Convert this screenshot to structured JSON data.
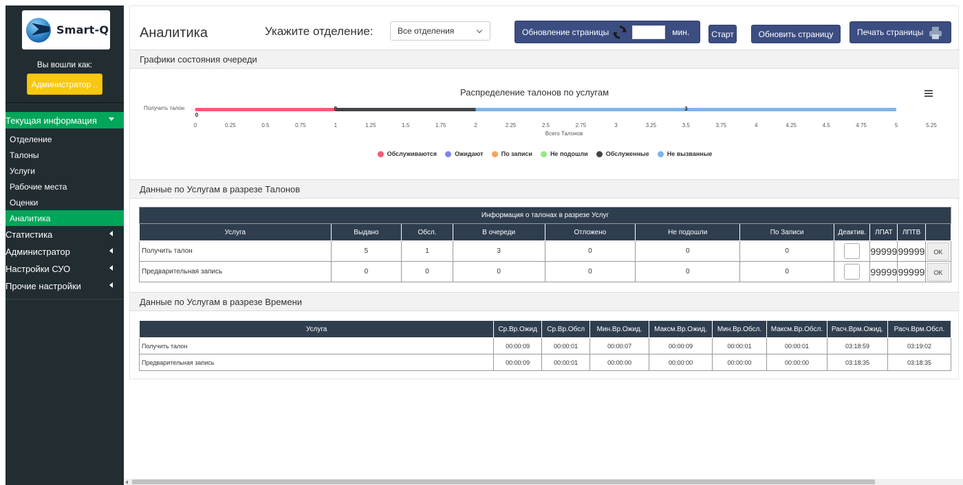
{
  "brand": {
    "name": "Smart-Q"
  },
  "sidebar": {
    "login_label": "Вы вошли как:",
    "role": "Администратор ..",
    "groups": [
      {
        "label": "Текущая информация",
        "expanded": true
      },
      {
        "label": "Статистика"
      },
      {
        "label": "Администратор"
      },
      {
        "label": "Настройки СУО"
      },
      {
        "label": "Прочие настройки"
      }
    ],
    "current_items": [
      "Отделение",
      "Талоны",
      "Услуги",
      "Рабочие места",
      "Оценки",
      "Аналитика"
    ],
    "active_item": "Аналитика"
  },
  "header": {
    "title": "Аналитика",
    "dept_label": "Укажите отделение:",
    "dept_value": "Все отделения",
    "refresh_label": "Обновление страницы",
    "refresh_value": "",
    "refresh_unit": "мин.",
    "start": "Старт",
    "update": "Обновить страницу",
    "print": "Печать страницы"
  },
  "sections": {
    "charts": "Графики состояния очереди",
    "by_tickets": "Данные по Услугам в разрезе Талонов",
    "by_time": "Данные по Услугам в разрезе Времени"
  },
  "chart_data": {
    "type": "bar",
    "orientation": "horizontal",
    "stacked": true,
    "title": "Распределение талонов по услугам",
    "xlabel": "Всего Талонов",
    "categories": [
      "Получить талон"
    ],
    "xlim": [
      0,
      5.25
    ],
    "xticks": [
      "0",
      "0.25",
      "0.5",
      "0.75",
      "1",
      "1.25",
      "1.5",
      "1.75",
      "2",
      "2.25",
      "2.5",
      "2.75",
      "3",
      "3.25",
      "3.5",
      "3.75",
      "4",
      "4.25",
      "4.5",
      "4.75",
      "5",
      "5.25"
    ],
    "series": [
      {
        "name": "Обслуживаются",
        "color": "#f45b7a",
        "values": [
          1
        ]
      },
      {
        "name": "Ожидают",
        "color": "#8085e9",
        "values": [
          0
        ]
      },
      {
        "name": "По записи",
        "color": "#f7a35c",
        "values": [
          0
        ]
      },
      {
        "name": "Не подошли",
        "color": "#90ed7d",
        "values": [
          0
        ]
      },
      {
        "name": "Обслуженные",
        "color": "#434348",
        "values": [
          1
        ]
      },
      {
        "name": "Не вызванные",
        "color": "#7cb5ec",
        "values": [
          3
        ]
      }
    ],
    "labels": [
      "0",
      "0",
      "0",
      "0",
      "",
      "3"
    ],
    "legend": "bottom"
  },
  "tickets_table": {
    "caption": "Информация о талонах в разрезе Услуг",
    "columns": [
      "Услуга",
      "Выдано",
      "Обсл.",
      "В очереди",
      "Отложено",
      "Не подошли",
      "По Записи",
      "Деактив.",
      "ЛПАТ",
      "ЛПТВ",
      ""
    ],
    "rows": [
      {
        "service": "Получить талон",
        "issued": "5",
        "served": "1",
        "queue": "3",
        "postponed": "0",
        "noshow": "0",
        "booked": "0",
        "lpat": "99999",
        "lptv": "99999",
        "ok": "OK"
      },
      {
        "service": "Предварительная запись",
        "issued": "0",
        "served": "0",
        "queue": "0",
        "postponed": "0",
        "noshow": "0",
        "booked": "0",
        "lpat": "99999",
        "lptv": "99999",
        "ok": "OK"
      }
    ]
  },
  "time_table": {
    "columns": [
      "Услуга",
      "Ср.Вр.Ожид",
      "Ср.Вр.Обсл",
      "Мин.Вр.Ожид.",
      "Максм.Вр.Ожид.",
      "Мин.Вр.Обсл.",
      "Максм.Вр.Обсл.",
      "Расч.Врм.Ожид.",
      "Расч.Врм.Обсл."
    ],
    "rows": [
      [
        "Получить талон",
        "00:00:09",
        "00:00:01",
        "00:00:07",
        "00:00:09",
        "00:00:01",
        "00:00:01",
        "03:18:59",
        "03:19:02"
      ],
      [
        "Предварительная запись",
        "00:00:09",
        "00:00:01",
        "00:00:00",
        "00:00:00",
        "00:00:00",
        "00:00:00",
        "03:18:35",
        "03:18:35"
      ]
    ]
  }
}
